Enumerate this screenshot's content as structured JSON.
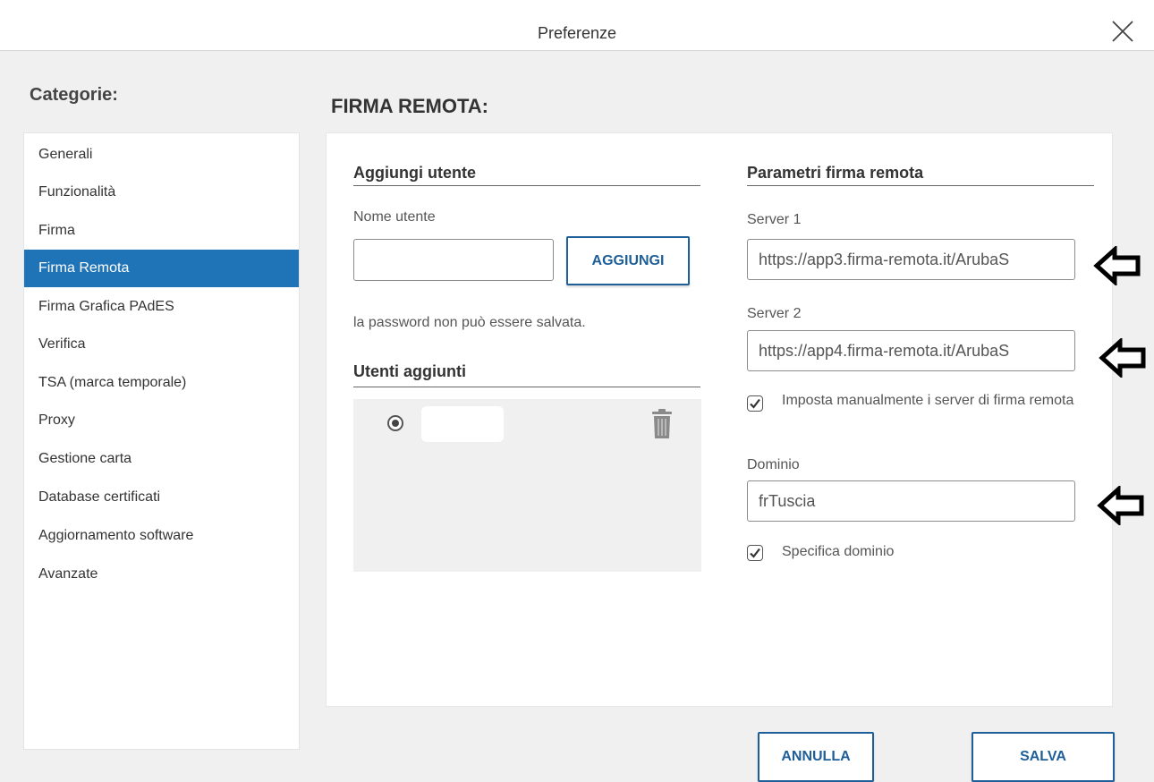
{
  "window": {
    "title": "Preferenze",
    "close_icon": "close-icon"
  },
  "sidebar": {
    "heading": "Categorie:",
    "items": [
      {
        "label": "Generali",
        "active": false
      },
      {
        "label": "Funzionalità",
        "active": false
      },
      {
        "label": "Firma",
        "active": false
      },
      {
        "label": "Firma Remota",
        "active": true
      },
      {
        "label": "Firma Grafica PAdES",
        "active": false
      },
      {
        "label": "Verifica",
        "active": false
      },
      {
        "label": "TSA (marca temporale)",
        "active": false
      },
      {
        "label": "Proxy",
        "active": false
      },
      {
        "label": "Gestione carta",
        "active": false
      },
      {
        "label": "Database certificati",
        "active": false
      },
      {
        "label": "Aggiornamento software",
        "active": false
      },
      {
        "label": "Avanzate",
        "active": false
      }
    ]
  },
  "main": {
    "section_title": "FIRMA REMOTA:",
    "add_user": {
      "heading": "Aggiungi utente",
      "username_label": "Nome utente",
      "username_value": "",
      "add_button": "AGGIUNGI",
      "note": "la password non può essere salvata."
    },
    "added_users": {
      "heading": "Utenti aggiunti",
      "users": [
        {
          "name": "",
          "selected": true,
          "delete_icon": "trash-icon"
        }
      ]
    },
    "remote_params": {
      "heading": "Parametri firma remota",
      "server1_label": "Server 1",
      "server1_value": "https://app3.firma-remota.it/ArubaS",
      "server2_label": "Server 2",
      "server2_value": "https://app4.firma-remota.it/ArubaS",
      "manual_servers_label": "Imposta manualmente i server di firma remota",
      "manual_servers_checked": true,
      "domain_label": "Dominio",
      "domain_value": "frTuscia",
      "specify_domain_label": "Specifica dominio",
      "specify_domain_checked": true
    }
  },
  "footer": {
    "cancel_button": "ANNULLA",
    "save_button": "SALVA"
  },
  "colors": {
    "accent": "#1f73b7",
    "button_border": "#1f5f99",
    "background": "#f0f0f0"
  }
}
